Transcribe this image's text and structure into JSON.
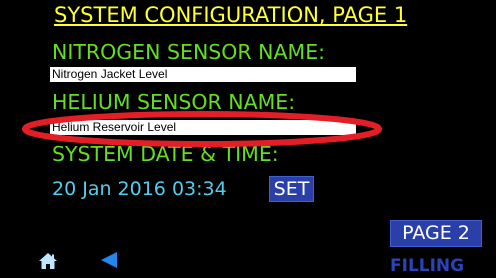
{
  "screen": {
    "title": "SYSTEM CONFIGURATION, PAGE 1",
    "nitrogen_label": "NITROGEN SENSOR NAME:",
    "nitrogen_value": "Nitrogen Jacket Level",
    "helium_label": "HELIUM SENSOR NAME:",
    "helium_value": "Helium Reservoir Level",
    "datetime_label": "SYSTEM DATE & TIME:",
    "datetime_value": "20 Jan 2016 03:34",
    "set_label": "SET",
    "page2_label": "PAGE 2",
    "status": "FILLING"
  },
  "icons": {
    "home": "home-icon",
    "back": "back-arrow-icon"
  },
  "colors": {
    "background": "#000000",
    "title": "#ffff33",
    "labels": "#66dd22",
    "datetime": "#55ccee",
    "button": "#2a3fa8",
    "status": "#2a44b8",
    "highlight_ring": "#e41e26"
  }
}
